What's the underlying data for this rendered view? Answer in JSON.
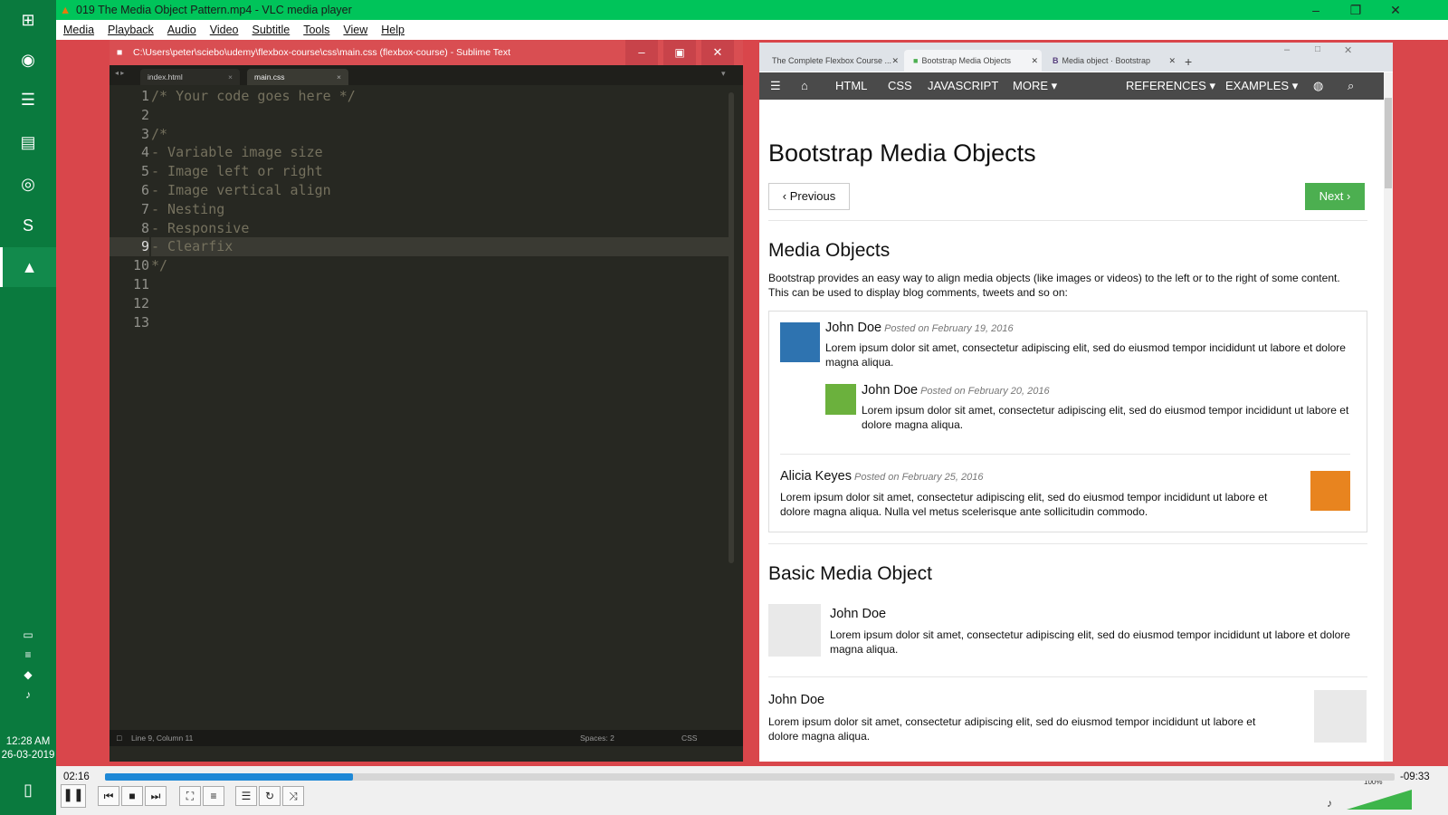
{
  "vlc": {
    "title": "019 The Media Object Pattern.mp4 - VLC media player",
    "menu": [
      "Media",
      "Playback",
      "Audio",
      "Video",
      "Subtitle",
      "Tools",
      "View",
      "Help"
    ],
    "elapsed": "02:16",
    "remaining": "-09:33",
    "volume": "100%",
    "progress_fraction": 0.192
  },
  "taskbar": {
    "time": "12:28 AM",
    "date": "26-03-2019",
    "icons": [
      "windows-start-icon",
      "chrome-icon",
      "vscode-icon",
      "file-explorer-icon",
      "target-app-icon",
      "sublime-text-icon",
      "vlc-icon"
    ]
  },
  "sublime": {
    "title": "C:\\Users\\peter\\sciebo\\udemy\\flexbox-course\\css\\main.css (flexbox-course) - Sublime Text",
    "tabs": [
      "index.html",
      "main.css"
    ],
    "line_numbers": [
      "1",
      "2",
      "3",
      "4",
      "5",
      "6",
      "7",
      "8",
      "9",
      "10",
      "11",
      "12",
      "13"
    ],
    "lines": [
      "/* Your code goes here */",
      "",
      "/*",
      "- Variable image size",
      "- Image left or right",
      "- Image vertical align",
      "- Nesting",
      "- Responsive",
      "- Clearfix",
      "*/",
      "",
      "",
      ""
    ],
    "status_left": "Line 9, Column 11",
    "status_spaces": "Spaces: 2",
    "status_syntax": "CSS"
  },
  "browser": {
    "tabs": [
      "The Complete Flexbox Course ...",
      "Bootstrap Media Objects",
      "Media object · Bootstrap"
    ],
    "nav": [
      "HTML",
      "CSS",
      "JAVASCRIPT",
      "MORE",
      "REFERENCES",
      "EXAMPLES"
    ],
    "page": {
      "title": "Bootstrap Media Objects",
      "prev": "Previous",
      "next": "Next",
      "section1": "Media Objects",
      "intro": "Bootstrap provides an easy way to align media objects (like images or videos) to the left or to the right of some content. This can be used to display blog comments, tweets and so on:",
      "c1_name": "John Doe",
      "c1_date": "Posted on February 19, 2016",
      "c1_text": "Lorem ipsum dolor sit amet, consectetur adipiscing elit, sed do eiusmod tempor incididunt ut labore et dolore magna aliqua.",
      "c2_name": "John Doe",
      "c2_date": "Posted on February 20, 2016",
      "c2_text": "Lorem ipsum dolor sit amet, consectetur adipiscing elit, sed do eiusmod tempor incididunt ut labore et dolore magna aliqua.",
      "c3_name": "Alicia Keyes",
      "c3_date": "Posted on February 25, 2016",
      "c3_text": "Lorem ipsum dolor sit amet, consectetur adipiscing elit, sed do eiusmod tempor incididunt ut labore et dolore magna aliqua. Nulla vel metus scelerisque ante sollicitudin commodo.",
      "section2": "Basic Media Object",
      "b1_name": "John Doe",
      "b1_text": "Lorem ipsum dolor sit amet, consectetur adipiscing elit, sed do eiusmod tempor incididunt ut labore et dolore magna aliqua.",
      "b2_name": "John Doe",
      "b2_text": "Lorem ipsum dolor sit amet, consectetur adipiscing elit, sed do eiusmod tempor incididunt ut labore et dolore magna aliqua."
    }
  },
  "colors": {
    "vlc_title": "#00c45a",
    "sublime_accent": "#d9464b",
    "w3_green": "#4caf50",
    "seek_fill": "#1e88d6"
  }
}
